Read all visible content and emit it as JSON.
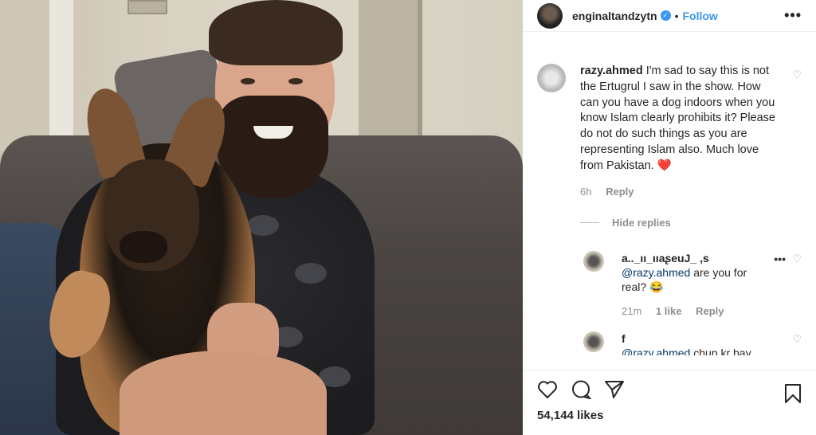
{
  "post": {
    "username": "enginaltandzytn",
    "follow_label": "Follow",
    "separator": "•"
  },
  "comment": {
    "username": "razy.ahmed",
    "text": "I'm sad to say this is not the Ertugrul I saw in the show. How can you have a dog indoors when you know Islam clearly prohibits it? Please do not do such things as you are representing Islam also. Much love from Pakistan. ❤️",
    "time": "6h",
    "reply_label": "Reply",
    "hide_replies": "Hide replies"
  },
  "replies": [
    {
      "username": "a.._ıı_ııaʂeuJ_ ,s",
      "mention": "@razy.ahmed",
      "text": "are you for real? 😂",
      "time": "21m",
      "likes": "1 like",
      "reply_label": "Reply"
    },
    {
      "username": "f",
      "mention": "@razy.ahmed",
      "text": "chup kr bay"
    }
  ],
  "actions": {
    "likes": "54,144 likes"
  },
  "icons": [
    "more-icon",
    "heart-icon",
    "comment-icon",
    "share-icon",
    "bookmark-icon",
    "verified-icon"
  ]
}
